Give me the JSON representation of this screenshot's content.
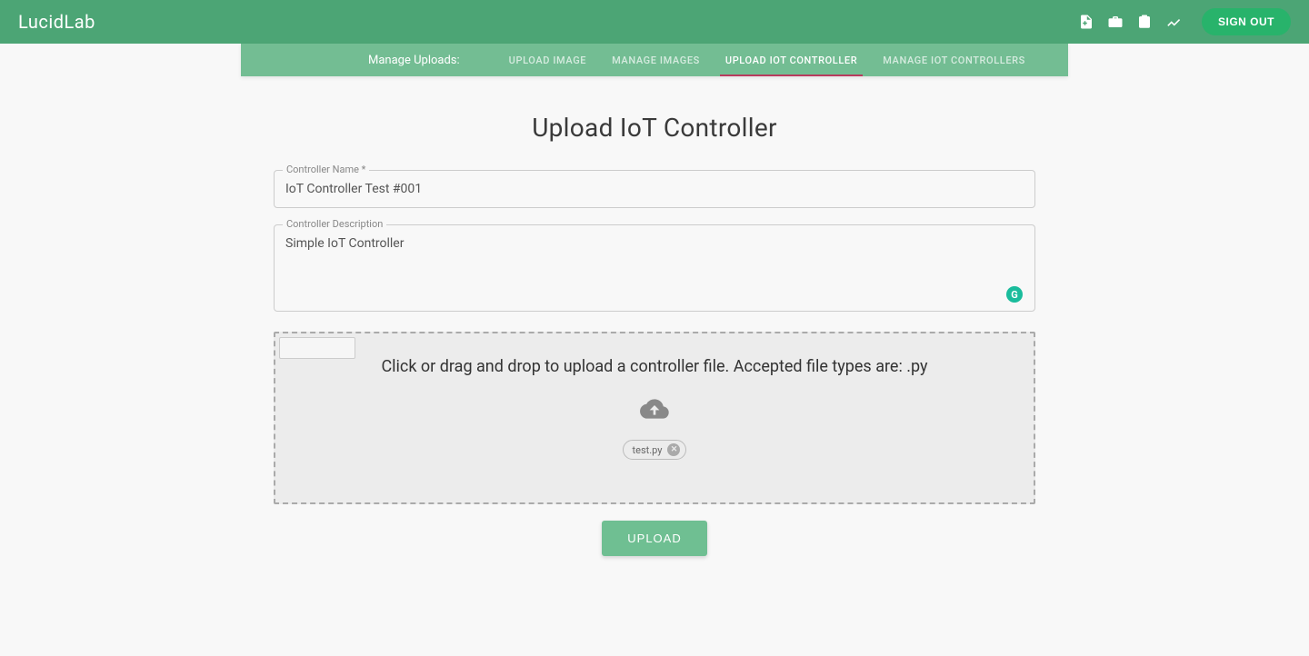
{
  "header": {
    "brand": "LucidLab",
    "signout": "SIGN OUT"
  },
  "tabs": {
    "label": "Manage Uploads:",
    "items": [
      {
        "label": "UPLOAD IMAGE",
        "active": false
      },
      {
        "label": "MANAGE IMAGES",
        "active": false
      },
      {
        "label": "UPLOAD IOT CONTROLLER",
        "active": true
      },
      {
        "label": "MANAGE IOT CONTROLLERS",
        "active": false
      }
    ]
  },
  "page": {
    "title": "Upload IoT Controller"
  },
  "form": {
    "name_label": "Controller Name *",
    "name_value": "IoT Controller Test #001",
    "desc_label": "Controller Description",
    "desc_value": "Simple IoT Controller",
    "grammar_badge": "G"
  },
  "dropzone": {
    "text": "Click or drag and drop to upload a controller file. Accepted file types are: .py",
    "file": "test.py"
  },
  "actions": {
    "upload": "UPLOAD"
  }
}
